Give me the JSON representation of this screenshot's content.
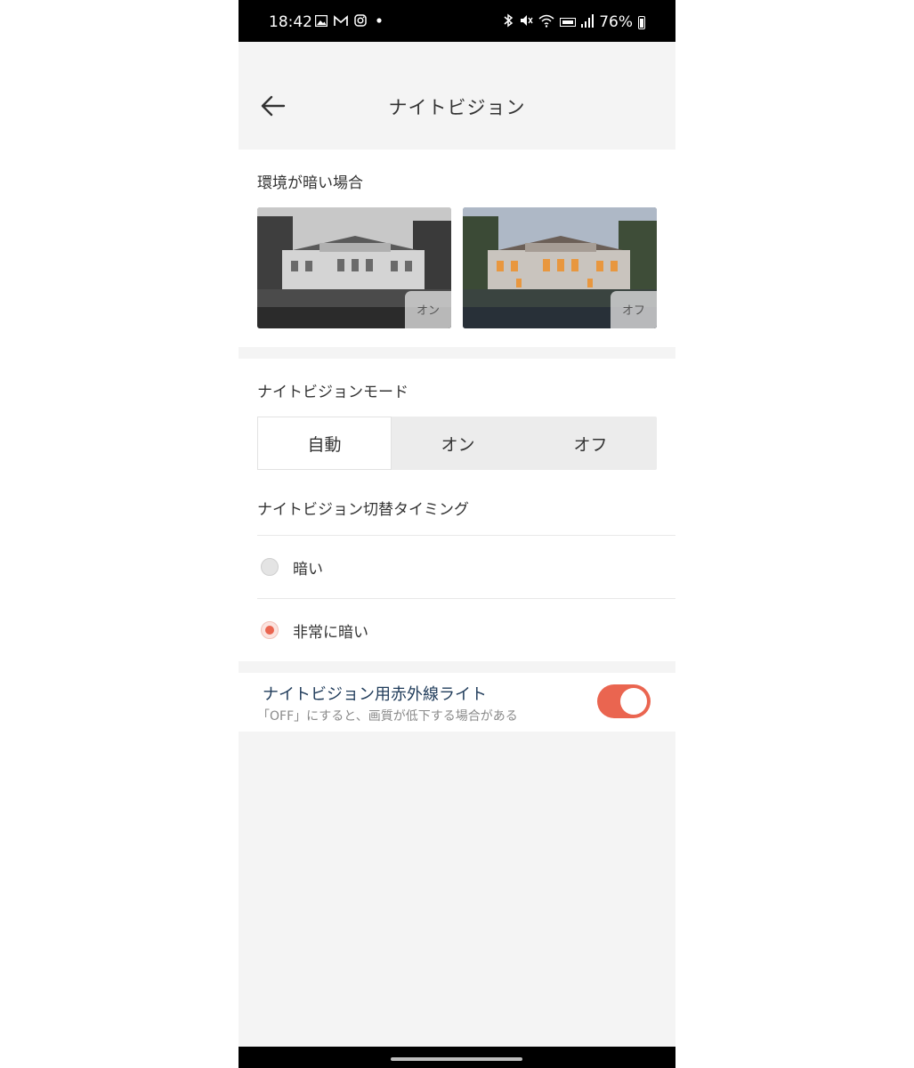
{
  "status_bar": {
    "time": "18:42",
    "left_icons": [
      "gallery-icon",
      "mail-icon",
      "instagram-icon",
      "dot-icon"
    ],
    "right_icons": [
      "bluetooth-icon",
      "mute-icon",
      "wifi-icon",
      "volte-icon",
      "signal-icon"
    ],
    "battery": "76%"
  },
  "header": {
    "back_icon": "arrow-left-icon",
    "title": "ナイトビジョン"
  },
  "environment": {
    "label": "環境が暗い場合",
    "images": [
      {
        "badge": "オン",
        "style": "grayscale"
      },
      {
        "badge": "オフ",
        "style": "color"
      }
    ]
  },
  "mode": {
    "label": "ナイトビジョンモード",
    "options": [
      "自動",
      "オン",
      "オフ"
    ],
    "selected": "自動"
  },
  "timing": {
    "label": "ナイトビジョン切替タイミング",
    "options": [
      {
        "label": "暗い",
        "checked": false
      },
      {
        "label": "非常に暗い",
        "checked": true
      }
    ]
  },
  "ir_light": {
    "title": "ナイトビジョン用赤外線ライト",
    "subtitle": "「OFF」にすると、画質が低下する場合がある",
    "enabled": true
  },
  "colors": {
    "accent": "#ea6550",
    "background": "#f4f4f4",
    "title_blue": "#1f3b5a"
  }
}
